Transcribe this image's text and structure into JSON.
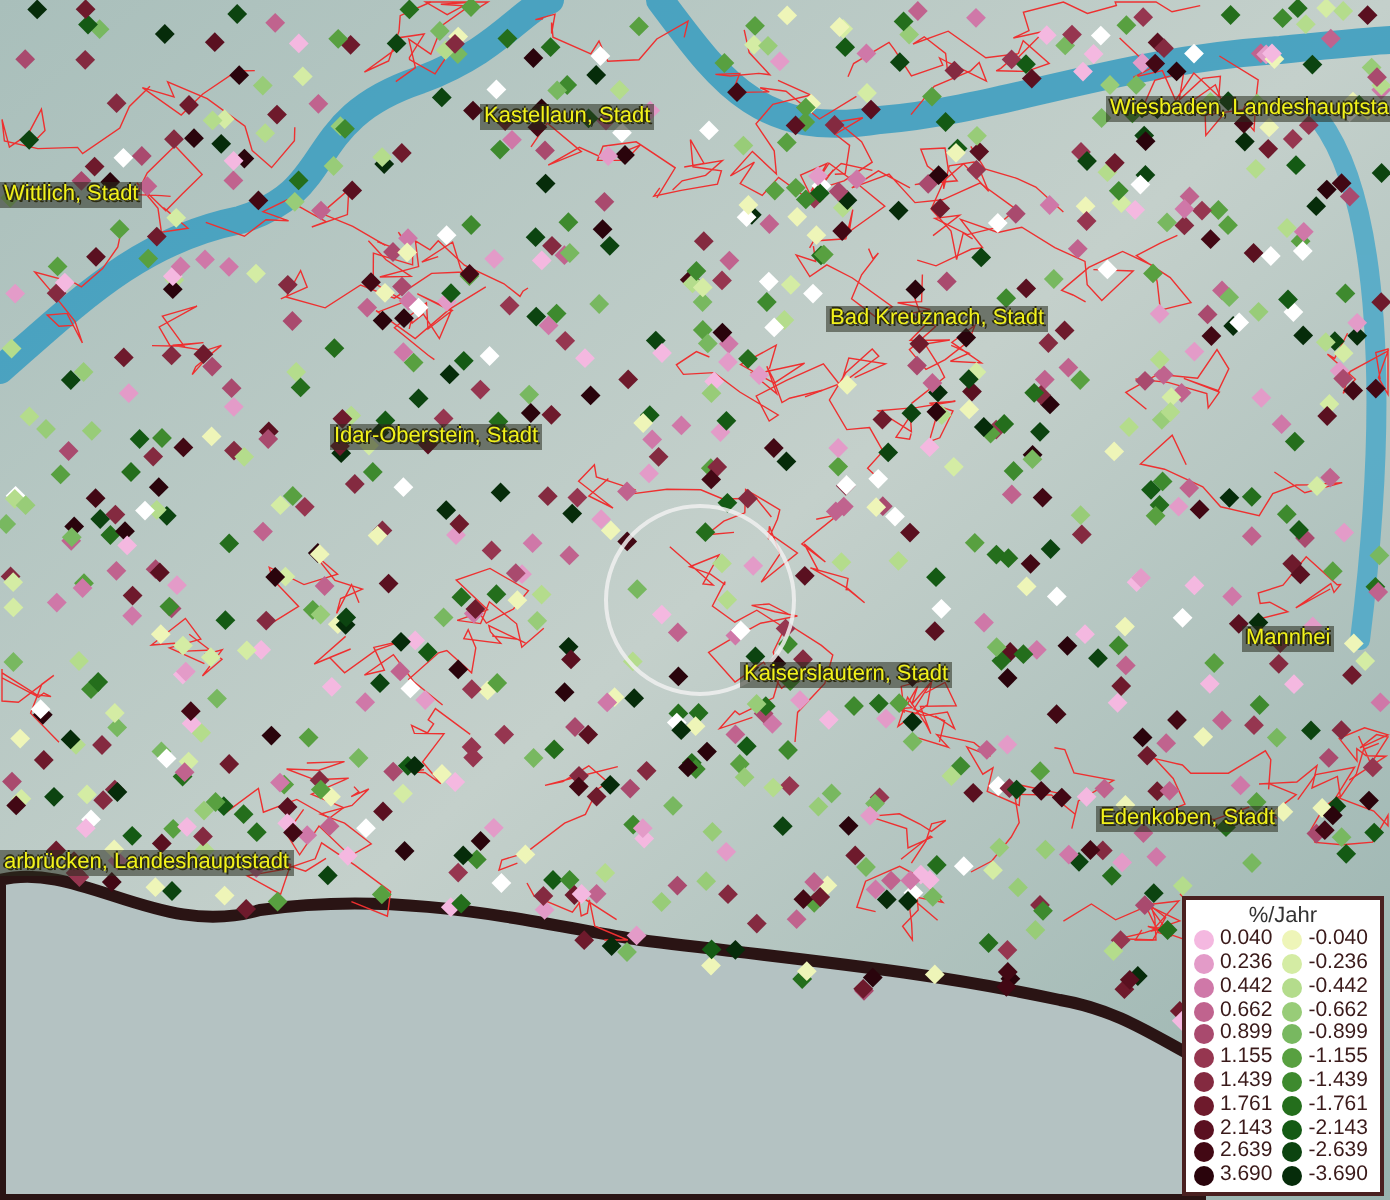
{
  "map": {
    "places": [
      {
        "name": "Kastellaun, Stadt"
      },
      {
        "name": "Wiesbaden, Landeshauptsta"
      },
      {
        "name": "Wittlich, Stadt"
      },
      {
        "name": "Bad Kreuznach, Stadt"
      },
      {
        "name": "Idar-Oberstein, Stadt"
      },
      {
        "name": "Mannhei"
      },
      {
        "name": "Kaiserslautern, Stadt"
      },
      {
        "name": "Edenkoben, Stadt"
      },
      {
        "name": "arbrücken, Landeshauptstadt"
      }
    ]
  },
  "legend": {
    "title": "%/Jahr",
    "rows": [
      {
        "left": {
          "value": "0.040",
          "color": "#f4b8e0"
        },
        "right": {
          "value": "-0.040",
          "color": "#eef5b8"
        }
      },
      {
        "left": {
          "value": "0.236",
          "color": "#e39bc8"
        },
        "right": {
          "value": "-0.236",
          "color": "#d4eca4"
        }
      },
      {
        "left": {
          "value": "0.442",
          "color": "#cf78a8"
        },
        "right": {
          "value": "-0.442",
          "color": "#b4dc8c"
        }
      },
      {
        "left": {
          "value": "0.662",
          "color": "#c0638e"
        },
        "right": {
          "value": "-0.662",
          "color": "#98cc78"
        }
      },
      {
        "left": {
          "value": "0.899",
          "color": "#a94a6e"
        },
        "right": {
          "value": "-0.899",
          "color": "#78b860"
        }
      },
      {
        "left": {
          "value": "1.155",
          "color": "#963650"
        },
        "right": {
          "value": "-1.155",
          "color": "#58a040"
        }
      },
      {
        "left": {
          "value": "1.439",
          "color": "#842a40"
        },
        "right": {
          "value": "-1.439",
          "color": "#3e8a2e"
        }
      },
      {
        "left": {
          "value": "1.761",
          "color": "#6e1a2c"
        },
        "right": {
          "value": "-1.761",
          "color": "#246e1c"
        }
      },
      {
        "left": {
          "value": "2.143",
          "color": "#5a1020"
        },
        "right": {
          "value": "-2.143",
          "color": "#145a14"
        }
      },
      {
        "left": {
          "value": "2.639",
          "color": "#420814"
        },
        "right": {
          "value": "-2.639",
          "color": "#0c4410"
        }
      },
      {
        "left": {
          "value": "3.690",
          "color": "#2a040c"
        },
        "right": {
          "value": "-3.690",
          "color": "#062c0a"
        }
      }
    ]
  }
}
